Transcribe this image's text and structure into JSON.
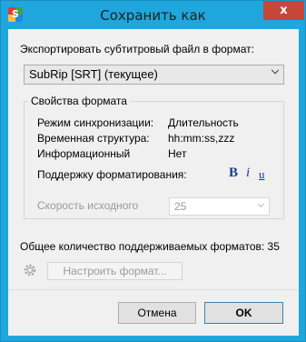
{
  "window": {
    "title": "Сохранить как",
    "close_glyph": "x",
    "app_icon": "subtitle-app-icon",
    "app_icon_letter": "S"
  },
  "export": {
    "label": "Экспортировать субтитровый файл в формат:",
    "selected_format": "SubRip [SRT] (текущее)"
  },
  "properties": {
    "group_title": "Свойства формата",
    "rows": [
      {
        "label": "Режим синхронизации:",
        "value": "Длительность"
      },
      {
        "label": "Временная структура:",
        "value": "hh:mm:ss,zzz"
      },
      {
        "label": "Информационный",
        "value": "Нет"
      }
    ],
    "formatting_label": "Поддержку форматирования:",
    "formatting_buttons": {
      "bold": "B",
      "italic": "i",
      "underline": "u"
    },
    "speed_label": "Скорость исходного",
    "speed_value": "25"
  },
  "supported_count_text": "Общее количество поддерживаемых форматов: 35",
  "setup_button": "Настроить формат...",
  "footer": {
    "cancel": "Отмена",
    "ok": "OK"
  },
  "colors": {
    "titlebar": "#1fa6dc",
    "close": "#c7463a",
    "format_icons": "#1a3b8f"
  }
}
